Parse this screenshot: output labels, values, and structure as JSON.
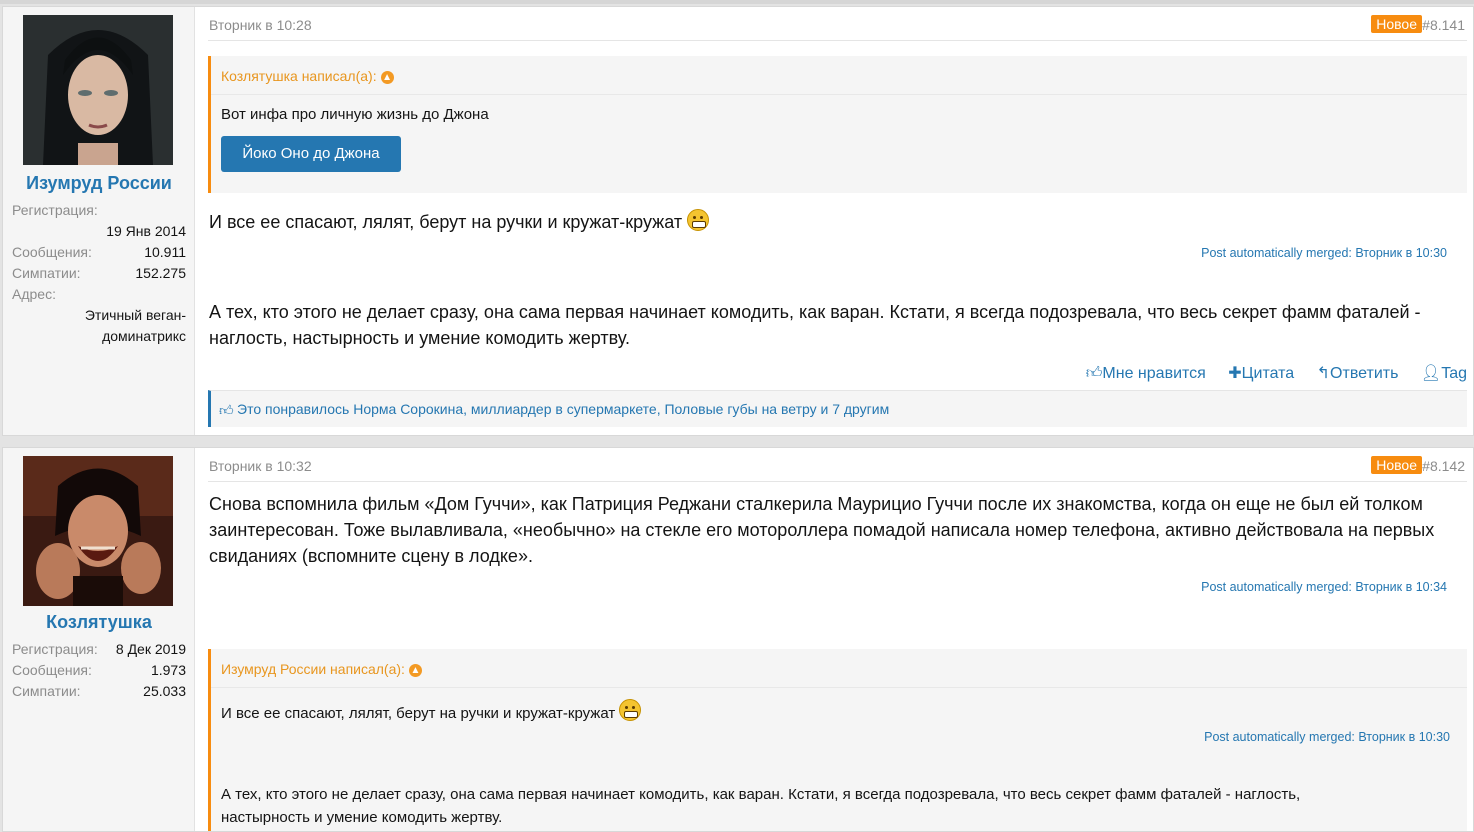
{
  "posts": [
    {
      "author": {
        "name": "Изумруд России",
        "reg_label": "Регистрация:",
        "reg_value": "19 Янв 2014",
        "msgs_label": "Сообщения:",
        "msgs_value": "10.911",
        "likes_label": "Симпатии:",
        "likes_value": "152.275",
        "addr_label": "Адрес:",
        "addr_value_1": "Этичный веган-",
        "addr_value_2": "доминатрикс"
      },
      "date": "Вторник в 10:28",
      "badge": "Новое",
      "number": "#8.141",
      "quote": {
        "author": "Козлятушка написал(а):",
        "text": "Вот инфа про личную жизнь до Джона",
        "button": "Йоко Оно до Джона"
      },
      "text1": "И все ее спасают, лялят, берут на ручки и кружат-кружат",
      "merged": "Post automatically merged: Вторник в 10:30",
      "text2": "А тех, кто этого не делает сразу, она сама первая начинает комодить, как варан. Кстати, я всегда подозревала, что весь секрет фамм фаталей - наглость, настырность и умение комодить жертву.",
      "actions": {
        "like": "Мне нравится",
        "quote": "Цитата",
        "reply": "Ответить",
        "tag": "Tag"
      },
      "likes_text": "Это понравилось Норма Сорокина, миллиардер в супермаркете, Половые губы на ветру и 7 другим"
    },
    {
      "author": {
        "name": "Козлятушка",
        "reg_label": "Регистрация:",
        "reg_value": "8 Дек 2019",
        "msgs_label": "Сообщения:",
        "msgs_value": "1.973",
        "likes_label": "Симпатии:",
        "likes_value": "25.033"
      },
      "date": "Вторник в 10:32",
      "badge": "Новое",
      "number": "#8.142",
      "text1": "Снова вспомнила фильм «Дом Гуччи», как Патриция Реджани сталкерила Маурицио Гуччи после их знакомства, когда он еще не был ей толком заинтересован. Тоже вылавливала, «необычно» на стекле его мотороллера помадой написала номер телефона, активно действовала на первых свиданиях (вспомните сцену в лодке».",
      "merged": "Post automatically merged: Вторник в 10:34",
      "quote": {
        "author": "Изумруд России написал(а):",
        "text1": "И все ее спасают, лялят, берут на ручки и кружат-кружат",
        "merged": "Post automatically merged: Вторник в 10:30",
        "text2": "А тех, кто этого не делает сразу, она сама первая начинает комодить, как варан. Кстати, я всегда подозревала, что весь секрет фамм фаталей - наглость, настырность и умение комодить жертву."
      }
    }
  ],
  "colors": {
    "accent": "#2577b1",
    "new_badge": "#f78c10",
    "quote_border": "#f78c10"
  }
}
